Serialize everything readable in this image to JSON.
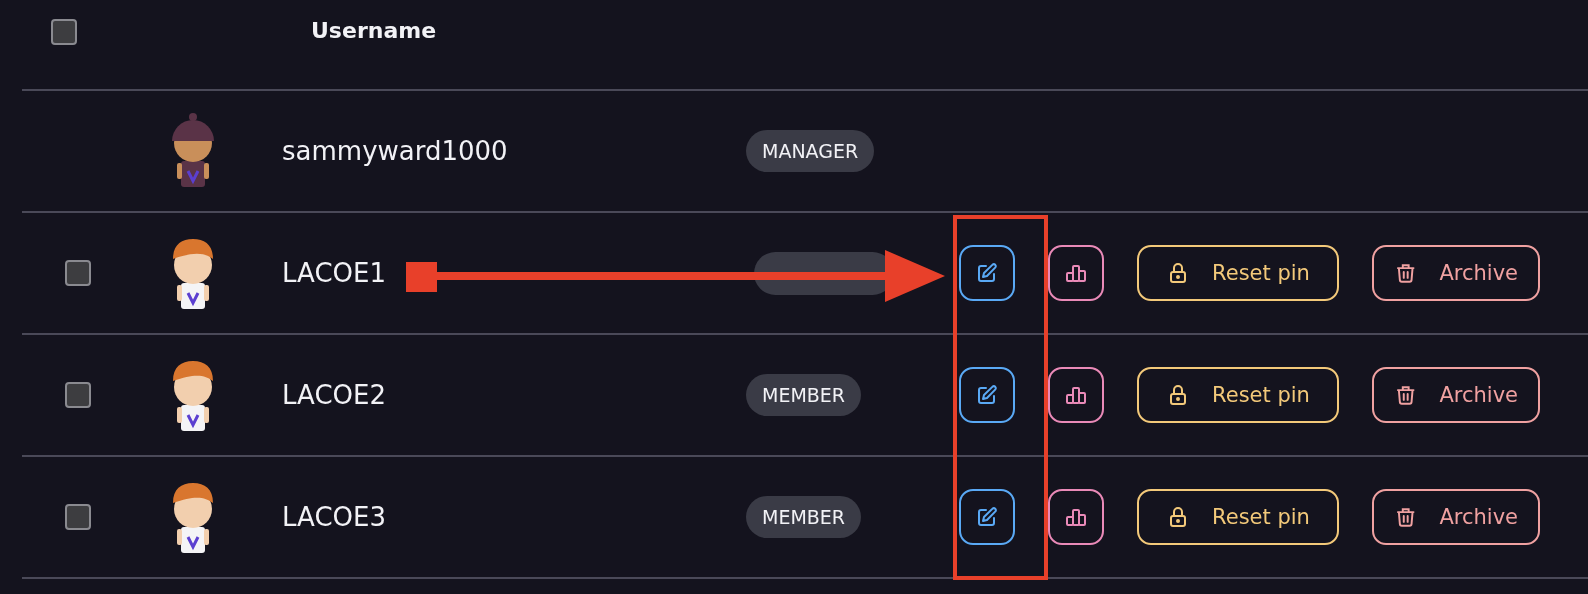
{
  "header": {
    "checked": false,
    "column": "Username"
  },
  "rows": [
    {
      "avatar": {
        "kind": "beanie"
      },
      "username": "sammyward1000",
      "role": "MANAGER",
      "actions": []
    },
    {
      "avatar": {
        "kind": "redhead"
      },
      "username": "LACOE1",
      "checked": false,
      "actions": [
        {
          "kind": "edit"
        },
        {
          "kind": "stats"
        },
        {
          "kind": "reset",
          "label": "Reset pin"
        },
        {
          "kind": "archive",
          "label": "Archive"
        }
      ]
    },
    {
      "avatar": {
        "kind": "redhead"
      },
      "username": "LACOE2",
      "role": "MEMBER",
      "checked": false,
      "actions": [
        {
          "kind": "edit"
        },
        {
          "kind": "stats"
        },
        {
          "kind": "reset",
          "label": "Reset pin"
        },
        {
          "kind": "archive",
          "label": "Archive"
        }
      ]
    },
    {
      "avatar": {
        "kind": "redhead"
      },
      "username": "LACOE3",
      "role": "MEMBER",
      "checked": false,
      "actions": [
        {
          "kind": "edit"
        },
        {
          "kind": "stats"
        },
        {
          "kind": "reset",
          "label": "Reset pin"
        },
        {
          "kind": "archive",
          "label": "Archive"
        }
      ]
    }
  ]
}
